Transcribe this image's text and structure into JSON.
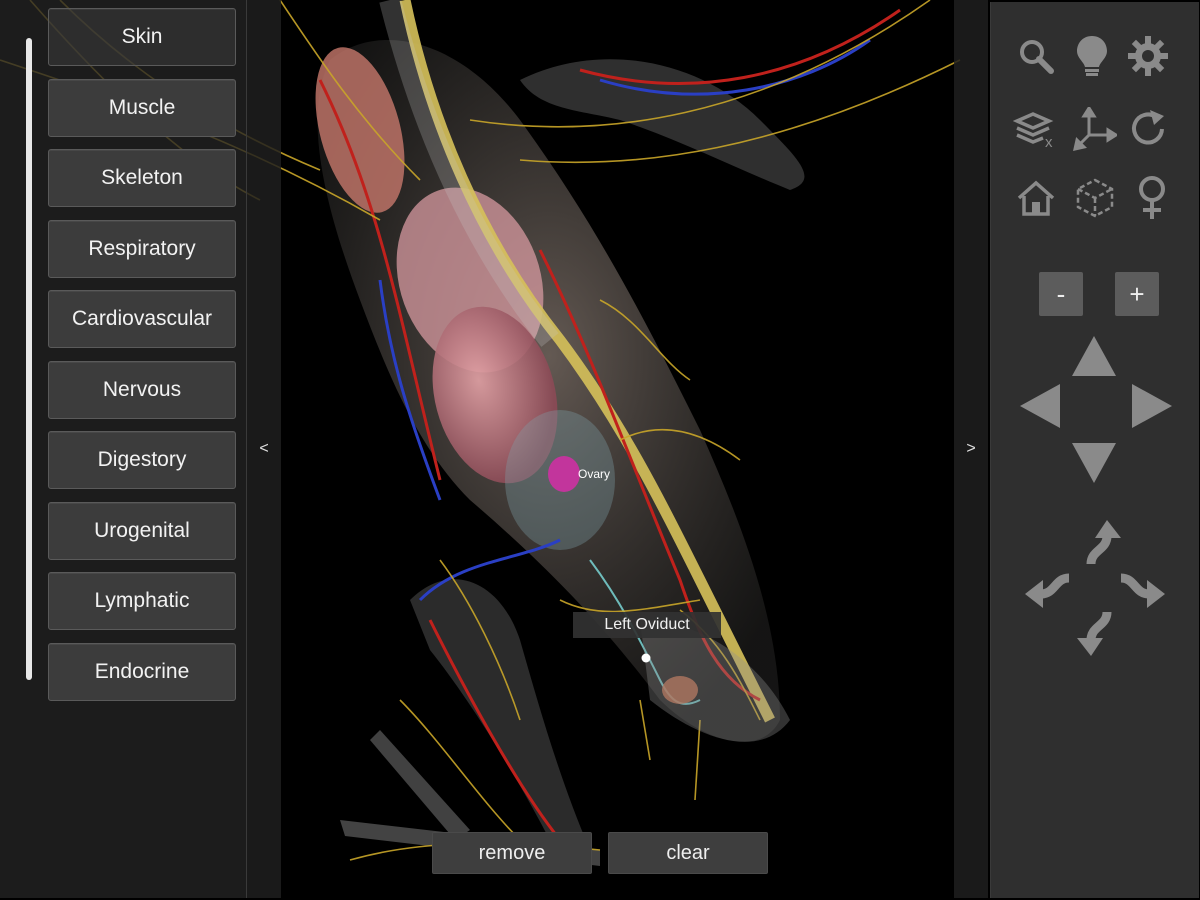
{
  "left_panel": {
    "systems": [
      {
        "label": "Skin"
      },
      {
        "label": "Muscle"
      },
      {
        "label": "Skeleton"
      },
      {
        "label": "Respiratory"
      },
      {
        "label": "Cardiovascular"
      },
      {
        "label": "Nervous"
      },
      {
        "label": "Digestory"
      },
      {
        "label": "Urogenital"
      },
      {
        "label": "Lymphatic"
      },
      {
        "label": "Endocrine"
      }
    ],
    "collapse_glyph": "<"
  },
  "right_panel": {
    "expand_glyph": ">",
    "tools": [
      {
        "icon": "search-icon"
      },
      {
        "icon": "lightbulb-icon"
      },
      {
        "icon": "gear-icon"
      },
      {
        "icon": "layers-clear-icon"
      },
      {
        "icon": "axes-icon"
      },
      {
        "icon": "rotate-icon"
      },
      {
        "icon": "home-icon"
      },
      {
        "icon": "cube-icon"
      },
      {
        "icon": "female-icon"
      }
    ],
    "zoom_out_label": "-",
    "zoom_in_label": "+"
  },
  "viewport": {
    "selected_label": "Left Oviduct",
    "ovary_label": "Ovary"
  },
  "actions": {
    "remove_label": "remove",
    "clear_label": "clear"
  },
  "colors": {
    "panel_bg": "#2f2f2f",
    "button_bg": "#3c3c3c",
    "icon_gray": "#8a8a8a",
    "nerve_yellow": "#c9a629",
    "artery_red": "#c0211c",
    "vein_blue": "#2a3fc4",
    "highlight_magenta": "#c2359c"
  }
}
